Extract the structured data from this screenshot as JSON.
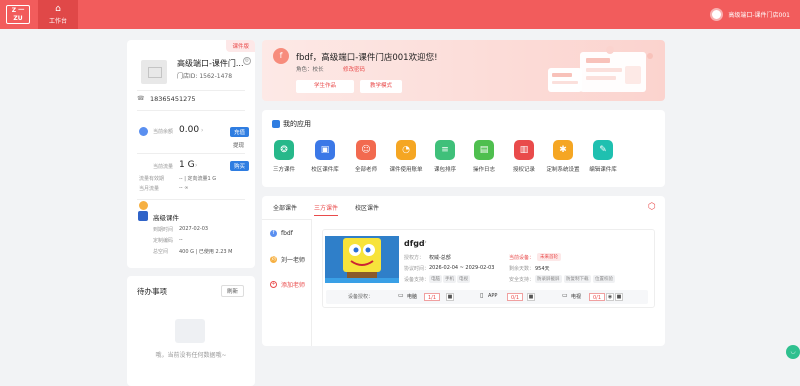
{
  "header": {
    "logo_text": "Z 一 ZU",
    "nav_home_label": "工作台",
    "user_name": "高级端口-课件门店001"
  },
  "store": {
    "badge": "课件版",
    "name": "高级端口-课件门...",
    "store_id": "门店ID: 1562-1478",
    "phone": "18365451275",
    "balance": {
      "label": "当前余额",
      "value": "0.00",
      "recharge": "充值",
      "withdraw": "提现"
    },
    "traffic": {
      "label": "当前流量",
      "value": "1 G",
      "buy": "购买",
      "expire": "流量有效期",
      "expire_val": "-- | 定向流量1 G",
      "current": "当月流量",
      "current_val": "-- ∞"
    },
    "plan": {
      "title": "高级课件",
      "lines": [
        {
          "k": "到期时间",
          "v": "2027-02-03"
        },
        {
          "k": "定制编码",
          "v": "--"
        },
        {
          "k": "总空间",
          "v": "400 G | 已使用 2.23 M"
        }
      ]
    }
  },
  "todo": {
    "title": "待办事项",
    "refresh": "刷新",
    "empty": "哦，当前没有任何数据哦~"
  },
  "welcome": {
    "avatar_letter": "f",
    "title": "fbdf，高级端口-课件门店001欢迎您!",
    "role_label": "角色：校长",
    "change_pwd": "修改密码",
    "btn_works": "学生作品",
    "btn_mode": "教学模式"
  },
  "apps": {
    "title": "我的应用",
    "items": [
      {
        "label": "三方课件",
        "color": "#27b88a",
        "icon": "❂"
      },
      {
        "label": "校区课件库",
        "color": "#3b78e7",
        "icon": "▣"
      },
      {
        "label": "全部老师",
        "color": "#f26a4f",
        "icon": "☺"
      },
      {
        "label": "课件使用账单",
        "color": "#f5a623",
        "icon": "◔"
      },
      {
        "label": "课包排序",
        "color": "#3fc07a",
        "icon": "≡"
      },
      {
        "label": "操作日志",
        "color": "#4fbf4f",
        "icon": "▤"
      },
      {
        "label": "授权记录",
        "color": "#e94b4b",
        "icon": "▥"
      },
      {
        "label": "定制系统设置",
        "color": "#f5a623",
        "icon": "✱"
      },
      {
        "label": "编辑课件库",
        "color": "#1fc0b0",
        "icon": "✎"
      }
    ]
  },
  "courses": {
    "tab_all": "全部课件",
    "tab_third": "三方课件",
    "tab_campus": "校区课件",
    "teachers": [
      {
        "letter": "f",
        "name": "fbdf"
      },
      {
        "letter": "刘",
        "name": "刘一老师"
      }
    ],
    "add_teacher": "添加老师",
    "item": {
      "title": "dfgd",
      "auth_label": "授权方：",
      "auth_val": "权威-总部",
      "period_label": "协议时间：",
      "period_val": "2026-02-04 ~ 2029-02-03",
      "device_label": "设备支持：",
      "device_tags": [
        "电脑",
        "手机",
        "电视"
      ],
      "status_label": "当前设备：",
      "status_val": "未来首轮",
      "remain_label": "剩余天数：",
      "remain_val": "954天",
      "safety_label": "安全支持：",
      "safety_tags": [
        "防录屏截屏",
        "防复制下载",
        "位置校验"
      ],
      "auth_row": {
        "label": "设备授权：",
        "groups": [
          {
            "name": "电脑",
            "val": "1/1"
          },
          {
            "name": "APP",
            "val": "0/1"
          },
          {
            "name": "电视",
            "val": "0/1"
          }
        ]
      }
    }
  },
  "colors": {
    "primary": "#f25c5c",
    "blue": "#2f7de1"
  }
}
